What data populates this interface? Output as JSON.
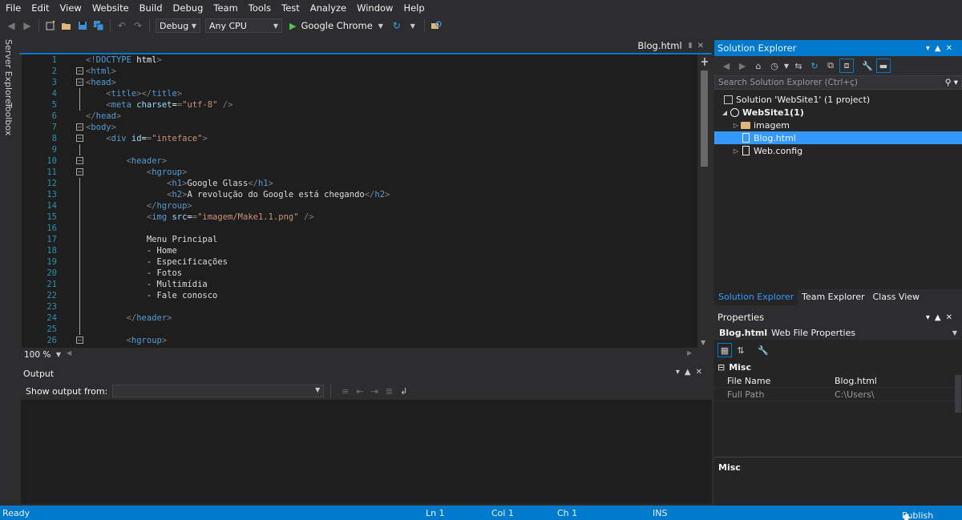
{
  "menu": [
    "File",
    "Edit",
    "View",
    "Website",
    "Build",
    "Debug",
    "Team",
    "Tools",
    "Test",
    "Analyze",
    "Window",
    "Help"
  ],
  "toolbar": {
    "config": "Debug",
    "platform": "Any CPU",
    "run_target": "Google Chrome"
  },
  "left_tabs": {
    "server_explorer": "Server Explorer",
    "toolbox": "Toolbox"
  },
  "document_tab": {
    "name": "Blog.html"
  },
  "editor": {
    "zoom": "100 %",
    "lines": [
      {
        "n": "1",
        "text": "<!DOCTYPE html>"
      },
      {
        "n": "2",
        "text": "<html>"
      },
      {
        "n": "3",
        "text": "<head>"
      },
      {
        "n": "4",
        "text": "    <title></title>"
      },
      {
        "n": "5",
        "text": "    <meta charset=\"utf-8\" />"
      },
      {
        "n": "6",
        "text": "</head>"
      },
      {
        "n": "7",
        "text": "<body>"
      },
      {
        "n": "8",
        "text": "    <div id=\"inteface\">"
      },
      {
        "n": "9",
        "text": ""
      },
      {
        "n": "10",
        "text": "        <header>"
      },
      {
        "n": "11",
        "text": "            <hgroup>"
      },
      {
        "n": "12",
        "text": "                <h1>Google Glass</h1>"
      },
      {
        "n": "13",
        "text": "                <h2>A revolução do Google está chegando</h2>"
      },
      {
        "n": "14",
        "text": "            </hgroup>"
      },
      {
        "n": "15",
        "text": "            <img src=\"imagem/Make1.1.png\" />"
      },
      {
        "n": "16",
        "text": ""
      },
      {
        "n": "17",
        "text": "            Menu Principal"
      },
      {
        "n": "18",
        "text": "            - Home"
      },
      {
        "n": "19",
        "text": "            - Especificações"
      },
      {
        "n": "20",
        "text": "            - Fotos"
      },
      {
        "n": "21",
        "text": "            - Multimídia"
      },
      {
        "n": "22",
        "text": "            - Fale conosco"
      },
      {
        "n": "23",
        "text": ""
      },
      {
        "n": "24",
        "text": "        </header>"
      },
      {
        "n": "25",
        "text": ""
      },
      {
        "n": "26",
        "text": "        <hgroup>"
      }
    ]
  },
  "output": {
    "title": "Output",
    "show_from_label": "Show output from:",
    "source": ""
  },
  "solution_explorer": {
    "title": "Solution Explorer",
    "search_placeholder": "Search Solution Explorer (Ctrl+ç)",
    "tree": [
      {
        "label": "Solution 'WebSite1' (1 project)",
        "depth": 0,
        "icon": "solution-icon",
        "bold": false
      },
      {
        "label": "WebSite1(1)",
        "depth": 1,
        "icon": "globe-icon",
        "bold": true
      },
      {
        "label": "imagem",
        "depth": 2,
        "icon": "folder-icon",
        "bold": false
      },
      {
        "label": "Blog.html",
        "depth": 2,
        "icon": "html-file-icon",
        "bold": false,
        "selected": true
      },
      {
        "label": "Web.config",
        "depth": 2,
        "icon": "config-file-icon",
        "bold": false
      }
    ],
    "tabs": [
      "Solution Explorer",
      "Team Explorer",
      "Class View"
    ]
  },
  "properties": {
    "title": "Properties",
    "object_name": "Blog.html",
    "object_type": "Web File Properties",
    "category": "Misc",
    "rows": [
      {
        "key": "File Name",
        "value": "Blog.html"
      },
      {
        "key": "Full Path",
        "value": "C:\\Users\\"
      }
    ],
    "description_title": "Misc"
  },
  "status": {
    "state": "Ready",
    "ln": "Ln 1",
    "col": "Col 1",
    "ch": "Ch 1",
    "mode": "INS",
    "publish": "Publish"
  },
  "colors": {
    "accent": "#007acc",
    "background": "#2d2d30",
    "editor_bg": "#1e1e1e",
    "line_number": "#2b91af",
    "tag": "#569cd6",
    "attribute": "#9cdcfe",
    "string": "#ce9178"
  }
}
